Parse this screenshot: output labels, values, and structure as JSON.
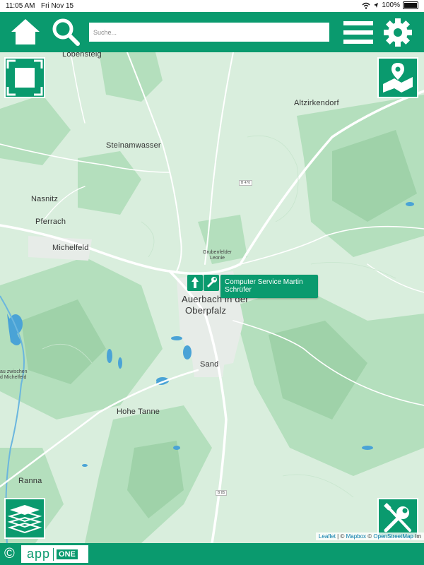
{
  "status_bar": {
    "time": "11:05 AM",
    "date": "Fri Nov 15",
    "battery": "100%"
  },
  "toolbar": {
    "home_icon": "home-icon",
    "search_icon": "search-icon",
    "search_placeholder": "Suche...",
    "menu_icon": "hamburger-menu-icon",
    "settings_icon": "gear-icon"
  },
  "map": {
    "places": [
      "Lobensteig",
      "Altzirkendorf",
      "Steinamwasser",
      "Nasnitz",
      "Pferrach",
      "Michelfeld",
      "Auerbach in der",
      "Oberpfalz",
      "Sand",
      "Hohe Tanne",
      "Ranna"
    ],
    "small_places": [
      "Grubenfelder",
      "Leonie",
      "au zwischen",
      "d Michelfeld"
    ],
    "road_labels": [
      "B 470",
      "B 85"
    ],
    "marker": {
      "label": "Computer Service Martin Schrüfer",
      "icons": [
        "arrow-up-icon",
        "wrench-icon"
      ]
    },
    "attribution": {
      "leaflet": "Leaflet",
      "sep1": " | © ",
      "mapbox": "Mapbox",
      "sep2": " © ",
      "osm": "OpenStreetMap",
      "trail": " Im"
    }
  },
  "controls": {
    "fullscreen_icon": "fullscreen-icon",
    "locate_icon": "map-location-icon",
    "layers_icon": "layers-icon",
    "tools_icon": "tools-icon"
  },
  "footer": {
    "copyright": "©",
    "brand_app": "app",
    "brand_one": "ONE"
  },
  "colors": {
    "brand": "#0a9a6e",
    "map_base": "#d9eedd",
    "forest": "#a9d9b3",
    "water": "#4aa3d6"
  }
}
